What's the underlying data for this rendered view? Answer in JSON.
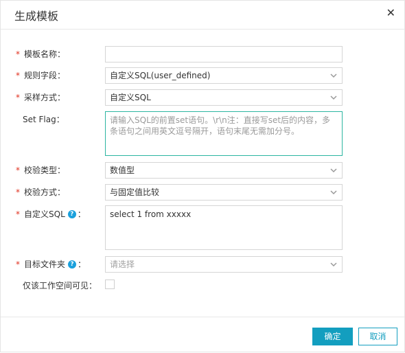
{
  "dialog": {
    "title": "生成模板",
    "close_glyph": "✕"
  },
  "form": {
    "required_mark": "*",
    "template_name": {
      "label": "模板名称：",
      "value": ""
    },
    "rule_field": {
      "label": "规则字段：",
      "value": "自定义SQL(user_defined)"
    },
    "sampling_method": {
      "label": "采样方式：",
      "value": "自定义SQL"
    },
    "set_flag": {
      "label": "Set Flag：",
      "placeholder": "请输入SQL的前置set语句。\\r\\n注：直接写set后的内容，多条语句之间用英文逗号隔开，语句末尾无需加分号。"
    },
    "check_type": {
      "label": "校验类型：",
      "value": "数值型"
    },
    "check_method": {
      "label": "校验方式：",
      "value": "与固定值比较"
    },
    "custom_sql": {
      "label": "自定义SQL",
      "label_suffix": "：",
      "value": "select 1 from xxxxx"
    },
    "target_folder": {
      "label": "目标文件夹",
      "label_suffix": "：",
      "placeholder": "请选择"
    },
    "workspace_visible": {
      "label": "仅该工作空间可见：",
      "checked": false
    },
    "help_glyph": "?"
  },
  "footer": {
    "ok_label": "确定",
    "cancel_label": "取消"
  },
  "colors": {
    "accent": "#139ebf",
    "required": "#e0301e",
    "help_icon": "#1aa0dc",
    "focus_border": "#2bb5a0"
  },
  "icons": [
    "close-icon",
    "chevron-down-icon",
    "help-icon"
  ]
}
